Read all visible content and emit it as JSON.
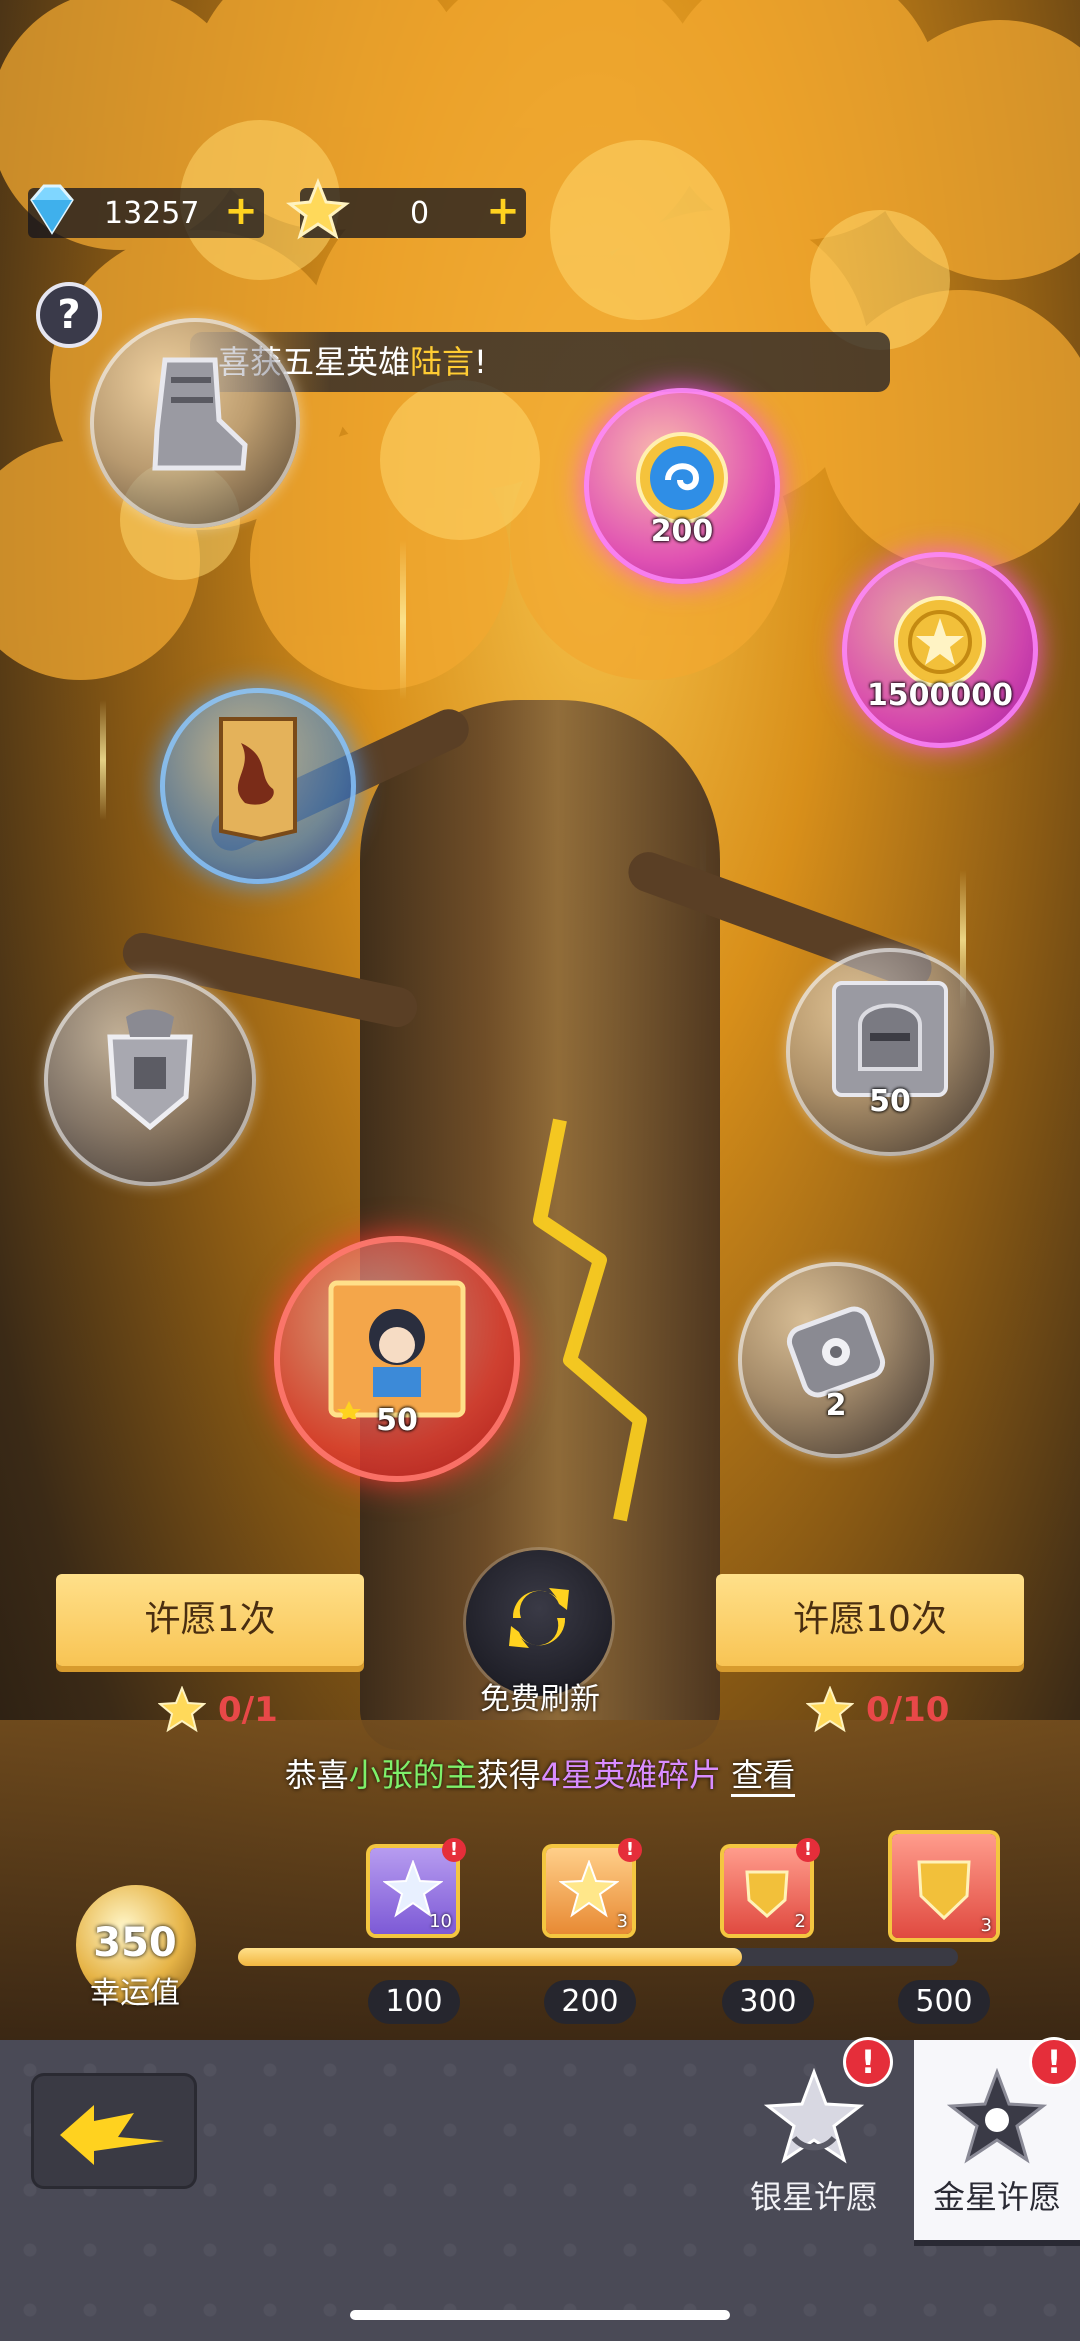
{
  "resources": {
    "diamonds": "13257",
    "stars": "0"
  },
  "banner": {
    "prefix": "喜获五星英雄",
    "hero": "陆言",
    "suffix": "!"
  },
  "bubbles": {
    "emblem_count": "200",
    "gold_count": "1500000",
    "helmet_count": "50",
    "hero_count": "50",
    "token_count": "2"
  },
  "actions": {
    "wish_once": "许愿1次",
    "wish_ten": "许愿10次",
    "refresh": "免费刷新",
    "cost_once": "0/1",
    "cost_ten": "0/10"
  },
  "ticker": {
    "a": "恭喜",
    "player": "小张的主",
    "b": "获得",
    "item": "4星英雄碎片",
    "view": "查看"
  },
  "luck": {
    "value": "350",
    "label": "幸运值",
    "progress_fraction": 0.7,
    "milestones": [
      "100",
      "200",
      "300",
      "500"
    ],
    "reward_counts": [
      "10",
      "3",
      "2",
      "3"
    ]
  },
  "tabs": {
    "silver": "银星许愿",
    "gold": "金星许愿",
    "badge": "!"
  },
  "colors": {
    "accent_gold": "#f8c454",
    "alert_red": "#e52e3a",
    "cost_red": "#e84848"
  }
}
